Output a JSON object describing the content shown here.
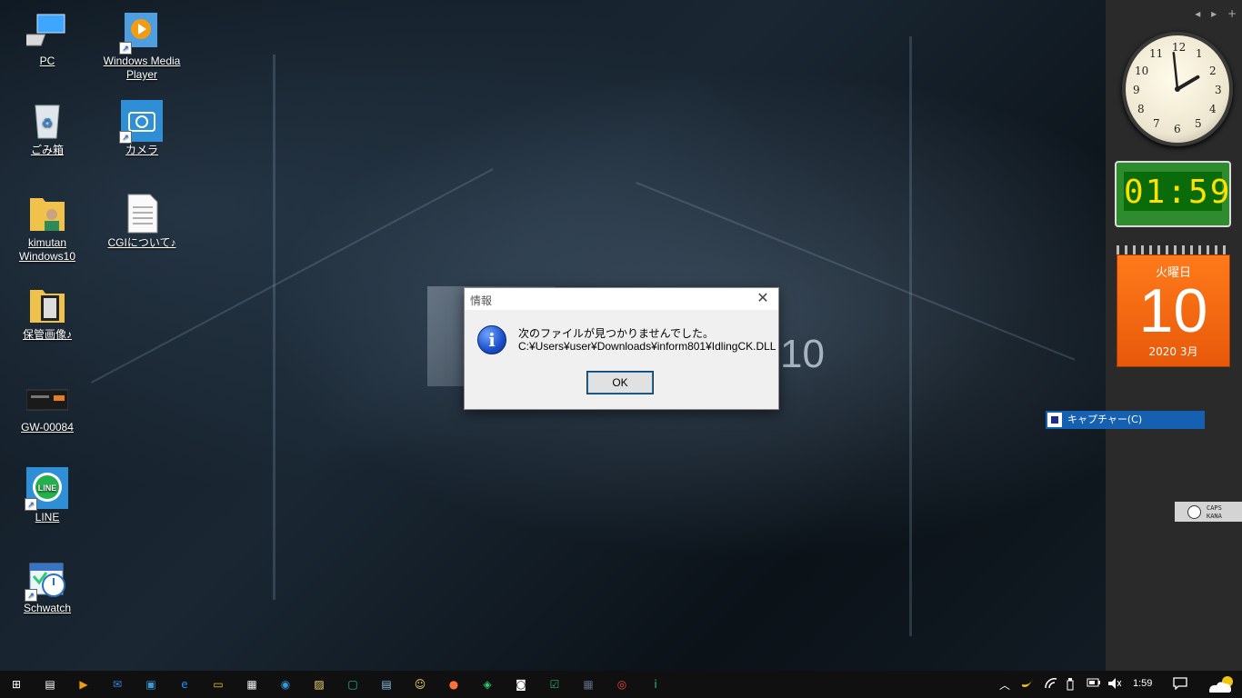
{
  "desktop": {
    "icons": [
      {
        "label": "PC",
        "icon": "pc-icon",
        "shortcut": false
      },
      {
        "label": "Windows Media Player",
        "icon": "media-player-icon",
        "shortcut": true
      },
      {
        "label": "ごみ箱",
        "icon": "recycle-bin-icon",
        "shortcut": false
      },
      {
        "label": "カメラ",
        "icon": "camera-icon",
        "shortcut": true
      },
      {
        "label": "kimutan Windows10",
        "icon": "user-folder-icon",
        "shortcut": false
      },
      {
        "label": "CGIについて♪",
        "icon": "text-document-icon",
        "shortcut": false
      },
      {
        "label": "保管画像♪",
        "icon": "image-folder-icon",
        "shortcut": false
      },
      {
        "label": "GW-00084",
        "icon": "image-file-icon",
        "shortcut": false
      },
      {
        "label": "LINE",
        "icon": "line-icon",
        "shortcut": true
      },
      {
        "label": "Schwatch",
        "icon": "calendar-clock-icon",
        "shortcut": true
      }
    ],
    "wallpaper_text": "10"
  },
  "dialog": {
    "title": "情報",
    "close_glyph": "✕",
    "icon": "info-icon",
    "message_line1": "次のファイルが見つかりませんでした。",
    "message_line2": "C:¥Users¥user¥Downloads¥inform801¥IdlingCK.DLL",
    "ok_label": "OK"
  },
  "sidebar": {
    "nav": {
      "prev": "◂",
      "next": "▸",
      "add": "+"
    },
    "analog_clock": {
      "numbers": [
        "12",
        "1",
        "2",
        "3",
        "4",
        "5",
        "6",
        "7",
        "8",
        "9",
        "10",
        "11"
      ],
      "hour": 1,
      "minute": 59
    },
    "digital_clock": {
      "time": "01:59"
    },
    "calendar": {
      "weekday": "火曜日",
      "day": "10",
      "month": "2020 3月"
    },
    "capture_menu": {
      "label": "キャプチャー(C)"
    },
    "ime": {
      "line1": "CAPS",
      "line2": "KANA"
    }
  },
  "taskbar": {
    "apps": [
      {
        "icon": "start-icon",
        "glyph": "⊞",
        "color": "#ffffff"
      },
      {
        "icon": "task-view-icon",
        "glyph": "▤",
        "color": "#ffffff"
      },
      {
        "icon": "media-player-icon",
        "glyph": "▶",
        "color": "#f39c12"
      },
      {
        "icon": "mail-icon",
        "glyph": "✉",
        "color": "#2e86de"
      },
      {
        "icon": "app-window-icon",
        "glyph": "▣",
        "color": "#3498db"
      },
      {
        "icon": "edge-icon",
        "glyph": "e",
        "color": "#1e90ff"
      },
      {
        "icon": "file-explorer-icon",
        "glyph": "▭",
        "color": "#f1c40f"
      },
      {
        "icon": "store-icon",
        "glyph": "▦",
        "color": "#ecf0f1"
      },
      {
        "icon": "chat-icon",
        "glyph": "◉",
        "color": "#3498db"
      },
      {
        "icon": "photo-icon",
        "glyph": "▨",
        "color": "#f5d76e"
      },
      {
        "icon": "capture-app-icon",
        "glyph": "▢",
        "color": "#1abc9c"
      },
      {
        "icon": "notepad-icon",
        "glyph": "▤",
        "color": "#85c1e9"
      },
      {
        "icon": "face-icon",
        "glyph": "☺",
        "color": "#f7dc6f"
      },
      {
        "icon": "firefox-icon",
        "glyph": "●",
        "color": "#ff7139"
      },
      {
        "icon": "feedly-icon",
        "glyph": "◈",
        "color": "#2ecc71"
      },
      {
        "icon": "camera-icon",
        "glyph": "◙",
        "color": "#ffffff"
      },
      {
        "icon": "checklist-icon",
        "glyph": "☑",
        "color": "#27ae60"
      },
      {
        "icon": "calendar-icon",
        "glyph": "▦",
        "color": "#5d6d7e"
      },
      {
        "icon": "chrome-icon",
        "glyph": "◎",
        "color": "#e74c3c"
      },
      {
        "icon": "info-app-icon",
        "glyph": "i",
        "color": "#2ecc71"
      }
    ],
    "tray": {
      "chevron": "︿",
      "time": "1:59",
      "notification_glyph": "▢"
    }
  }
}
